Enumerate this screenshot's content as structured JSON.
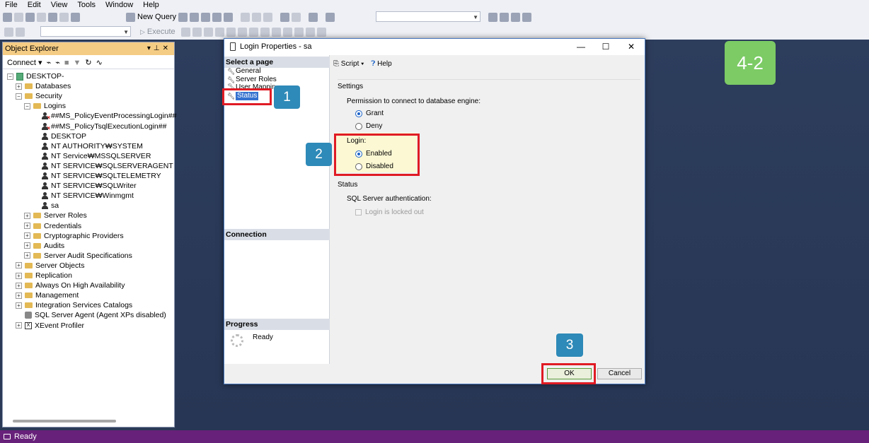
{
  "menu": [
    "File",
    "Edit",
    "View",
    "Tools",
    "Window",
    "Help"
  ],
  "toolbar": {
    "new_query": "New Query",
    "execute": "Execute"
  },
  "object_explorer": {
    "title": "Object Explorer",
    "connect": "Connect",
    "tree": [
      {
        "label": "DESKTOP-",
        "depth": 0,
        "expander": "-",
        "icon": "server-icon"
      },
      {
        "label": "Databases",
        "depth": 1,
        "expander": "+",
        "icon": "folder-icon"
      },
      {
        "label": "Security",
        "depth": 1,
        "expander": "-",
        "icon": "folder-icon"
      },
      {
        "label": "Logins",
        "depth": 2,
        "expander": "-",
        "icon": "folder-icon"
      },
      {
        "label": "##MS_PolicyEventProcessingLogin##",
        "depth": 3,
        "expander": "",
        "icon": "user-disabled-icon"
      },
      {
        "label": "##MS_PolicyTsqlExecutionLogin##",
        "depth": 3,
        "expander": "",
        "icon": "user-disabled-icon"
      },
      {
        "label": "DESKTOP",
        "depth": 3,
        "expander": "",
        "icon": "user-icon"
      },
      {
        "label": "NT AUTHORITY₩SYSTEM",
        "depth": 3,
        "expander": "",
        "icon": "user-icon"
      },
      {
        "label": "NT Service₩MSSQLSERVER",
        "depth": 3,
        "expander": "",
        "icon": "user-icon"
      },
      {
        "label": "NT SERVICE₩SQLSERVERAGENT",
        "depth": 3,
        "expander": "",
        "icon": "user-icon"
      },
      {
        "label": "NT SERVICE₩SQLTELEMETRY",
        "depth": 3,
        "expander": "",
        "icon": "user-icon"
      },
      {
        "label": "NT SERVICE₩SQLWriter",
        "depth": 3,
        "expander": "",
        "icon": "user-icon"
      },
      {
        "label": "NT SERVICE₩Winmgmt",
        "depth": 3,
        "expander": "",
        "icon": "user-icon"
      },
      {
        "label": "sa",
        "depth": 3,
        "expander": "",
        "icon": "user-icon"
      },
      {
        "label": "Server Roles",
        "depth": 2,
        "expander": "+",
        "icon": "folder-icon"
      },
      {
        "label": "Credentials",
        "depth": 2,
        "expander": "+",
        "icon": "folder-icon"
      },
      {
        "label": "Cryptographic Providers",
        "depth": 2,
        "expander": "+",
        "icon": "folder-icon"
      },
      {
        "label": "Audits",
        "depth": 2,
        "expander": "+",
        "icon": "folder-icon"
      },
      {
        "label": "Server Audit Specifications",
        "depth": 2,
        "expander": "+",
        "icon": "folder-icon"
      },
      {
        "label": "Server Objects",
        "depth": 1,
        "expander": "+",
        "icon": "folder-icon"
      },
      {
        "label": "Replication",
        "depth": 1,
        "expander": "+",
        "icon": "folder-icon"
      },
      {
        "label": "Always On High Availability",
        "depth": 1,
        "expander": "+",
        "icon": "folder-icon"
      },
      {
        "label": "Management",
        "depth": 1,
        "expander": "+",
        "icon": "folder-icon"
      },
      {
        "label": "Integration Services Catalogs",
        "depth": 1,
        "expander": "+",
        "icon": "folder-icon"
      },
      {
        "label": "SQL Server Agent (Agent XPs disabled)",
        "depth": 1,
        "expander": "",
        "icon": "agent-icon"
      },
      {
        "label": "XEvent Profiler",
        "depth": 1,
        "expander": "+",
        "icon": "xevent-icon"
      }
    ]
  },
  "dialog": {
    "title": "Login Properties - sa",
    "select_page": "Select a page",
    "pages": [
      "General",
      "Server Roles",
      "User Mappin",
      "Status"
    ],
    "connection": "Connection",
    "progress": "Progress",
    "progress_status": "Ready",
    "script": "Script",
    "help": "Help",
    "settings": "Settings",
    "permission_label": "Permission to connect to database engine:",
    "grant": "Grant",
    "deny": "Deny",
    "login_label": "Login:",
    "enabled": "Enabled",
    "disabled": "Disabled",
    "status": "Status",
    "sql_auth": "SQL Server authentication:",
    "locked_out": "Login is locked out",
    "ok": "OK",
    "cancel": "Cancel"
  },
  "annotations": {
    "badge1": "1",
    "badge2": "2",
    "badge3": "3",
    "step": "4-2"
  },
  "statusbar": {
    "text": "Ready"
  },
  "colors": {
    "accent_red": "#e01b24",
    "badge_blue": "#2e8ab8",
    "step_green": "#7ccb65",
    "status_purple": "#68217a"
  }
}
